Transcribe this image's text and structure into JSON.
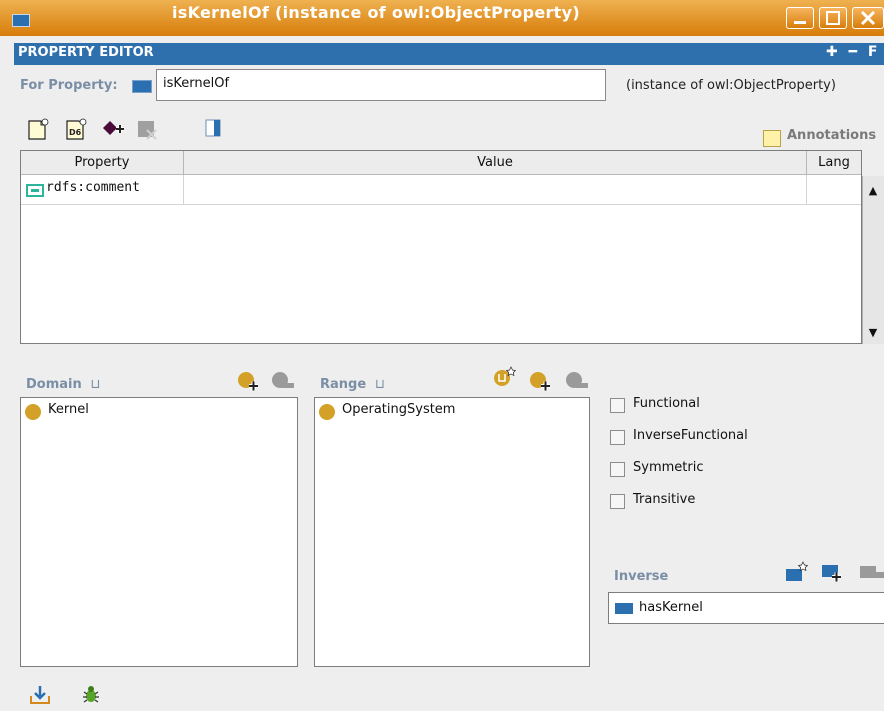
{
  "window": {
    "title": "isKernelOf   (instance of owl:ObjectProperty)",
    "controls": [
      "minimize",
      "maximize",
      "close"
    ]
  },
  "header": {
    "title": "PROPERTY EDITOR",
    "tools": "✚ ━ F T"
  },
  "for_property": {
    "label": "For Property:",
    "value": "isKernelOf",
    "instance_of": "(instance of owl:ObjectProperty)"
  },
  "toolbar": {
    "icons": [
      "create-annotation-icon",
      "create-named-annotation-icon",
      "add-annotation-property-icon",
      "delete-annotation-icon",
      "view-icon"
    ],
    "annotations_label": "Annotations"
  },
  "annotations_table": {
    "headers": {
      "property": "Property",
      "value": "Value",
      "lang": "Lang"
    },
    "rows": [
      {
        "property": "rdfs:comment",
        "value": "",
        "lang": ""
      }
    ]
  },
  "domain": {
    "label": "Domain",
    "items": [
      "Kernel"
    ]
  },
  "range": {
    "label": "Range",
    "items": [
      "OperatingSystem"
    ]
  },
  "characteristics": {
    "functional": {
      "label": "Functional",
      "checked": false
    },
    "inverse_functional": {
      "label": "InverseFunctional",
      "checked": false
    },
    "symmetric": {
      "label": "Symmetric",
      "checked": false
    },
    "transitive": {
      "label": "Transitive",
      "checked": false
    }
  },
  "inverse": {
    "label": "Inverse",
    "value": "hasKernel"
  },
  "footer_icons": [
    "export-icon",
    "bug-icon"
  ],
  "colors": {
    "titlebar": "#e08f22",
    "header": "#2e6fad",
    "class_dot": "#d3a128",
    "property_blue": "#2a6fb0",
    "label_gray_blue": "#7a8ea5"
  }
}
